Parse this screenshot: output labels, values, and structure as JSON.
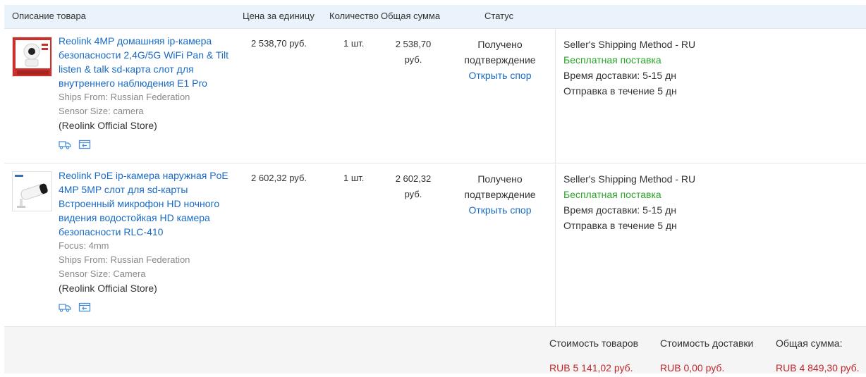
{
  "header": {
    "description": "Описание товара",
    "unit_price": "Цена за единицу",
    "quantity": "Количество",
    "total": "Общая сумма",
    "status": "Статус"
  },
  "items": [
    {
      "title": "Reolink 4MP домашняя ip-камера безопасности 2,4G/5G WiFi Pan & Tilt listen & talk sd-карта слот для внутреннего наблюдения E1 Pro",
      "meta": [
        "Ships From: Russian Federation",
        "Sensor Size: camera"
      ],
      "store": "(Reolink Official Store)",
      "unit_price": "2 538,70 руб.",
      "quantity": "1 шт.",
      "total_line1": "2 538,70",
      "total_line2": "руб.",
      "status_line1": "Получено",
      "status_line2": "подтверждение",
      "dispute": "Открыть спор",
      "shipping_method": "Seller's Shipping Method - RU",
      "shipping_free": "Бесплатная поставка",
      "delivery_time": "Время доставки: 5-15 дн",
      "dispatch": "Отправка в течение 5 дн"
    },
    {
      "title": "Reolink PoE ip-камера наружная PoE 4MP 5MP слот для sd-карты Встроенный микрофон HD ночного видения водостойкая HD камера безопасности RLC-410",
      "meta": [
        "Focus: 4mm",
        "Ships From: Russian Federation",
        "Sensor Size: Camera"
      ],
      "store": "(Reolink Official Store)",
      "unit_price": "2 602,32 руб.",
      "quantity": "1 шт.",
      "total_line1": "2 602,32",
      "total_line2": "руб.",
      "status_line1": "Получено",
      "status_line2": "подтверждение",
      "dispute": "Открыть спор",
      "shipping_method": "Seller's Shipping Method - RU",
      "shipping_free": "Бесплатная поставка",
      "delivery_time": "Время доставки: 5-15 дн",
      "dispatch": "Отправка в течение 5 дн"
    }
  ],
  "footer": {
    "goods_label": "Стоимость товаров",
    "goods_value": "RUB 5 141,02 руб.",
    "shipping_label": "Стоимость доставки",
    "shipping_value": "RUB 0,00 руб.",
    "total_label": "Общая сумма:",
    "total_value": "RUB 4 849,30 руб."
  },
  "icons": [
    "delivery-truck-icon",
    "return-icon"
  ],
  "colors": {
    "link": "#1a6bc4",
    "free_shipping": "#2aa52a",
    "price_red": "#c0272d",
    "header_bg": "#eaf3fb"
  }
}
